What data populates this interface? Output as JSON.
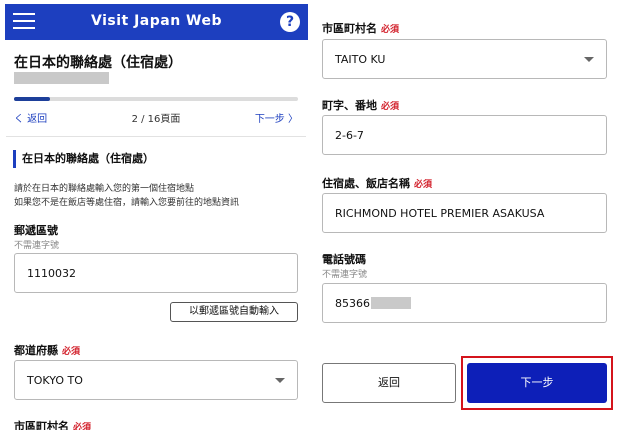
{
  "header": {
    "title": "Visit Japan Web",
    "help_glyph": "?",
    "menu_icon": "hamburger-menu-icon",
    "brand_color": "#1d3fbf"
  },
  "page": {
    "title": "在日本的聯絡處（住宿處）",
    "progress_fraction": 0.125,
    "back_label": "く 返回",
    "page_count": "2 / 16頁面",
    "next_label": "下一步 〉"
  },
  "section": {
    "heading": "在日本的聯絡處（住宿處）",
    "desc_line1": "請於在日本的聯絡處輸入您的第一個住宿地點",
    "desc_line2": "如果您不是在飯店等處住宿，請輸入您要前往的地點資訊"
  },
  "required_tag": "必須",
  "fields": {
    "postal": {
      "label": "郵遞區號",
      "note": "不需連字號",
      "value": "1110032",
      "auto_button": "以郵遞區號自動輸入"
    },
    "prefecture": {
      "label": "都道府縣",
      "value": "TOKYO TO"
    },
    "city": {
      "label": "市區町村名",
      "value": "TAITO KU"
    },
    "street": {
      "label": "町字、番地",
      "value": "2-6-7"
    },
    "hotel": {
      "label": "住宿處、飯店名稱",
      "value": "RICHMOND HOTEL PREMIER ASAKUSA"
    },
    "phone": {
      "label": "電話號碼",
      "note": "不需連字號",
      "value": "85366"
    }
  },
  "footer": {
    "back_button": "返回",
    "next_button": "下一步",
    "next_button_color": "#0d1fb8",
    "highlight_color": "#d4141c"
  }
}
